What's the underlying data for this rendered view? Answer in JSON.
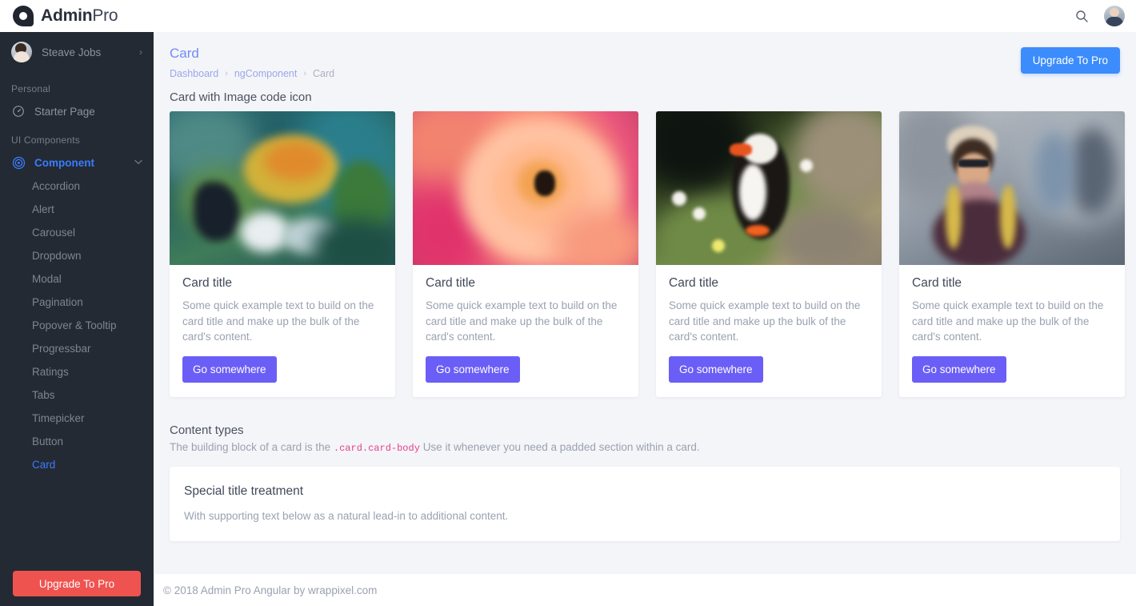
{
  "topbar": {
    "brand_bold": "Admin",
    "brand_light": "Pro",
    "search_icon": "search-icon",
    "avatar": "user-avatar"
  },
  "sidebar": {
    "profile": {
      "name": "Steave Jobs",
      "chevron": "›"
    },
    "sections": [
      {
        "label": "Personal"
      },
      {
        "label": "UI Components"
      }
    ],
    "starter_page": {
      "label": "Starter Page",
      "icon": "speedometer-icon"
    },
    "component": {
      "label": "Component",
      "icon": "target-icon",
      "chevron": "⌄"
    },
    "sub_items": [
      {
        "label": "Accordion",
        "active": false
      },
      {
        "label": "Alert",
        "active": false
      },
      {
        "label": "Carousel",
        "active": false
      },
      {
        "label": "Dropdown",
        "active": false
      },
      {
        "label": "Modal",
        "active": false
      },
      {
        "label": "Pagination",
        "active": false
      },
      {
        "label": "Popover & Tooltip",
        "active": false
      },
      {
        "label": "Progressbar",
        "active": false
      },
      {
        "label": "Ratings",
        "active": false
      },
      {
        "label": "Tabs",
        "active": false
      },
      {
        "label": "Timepicker",
        "active": false
      },
      {
        "label": "Button",
        "active": false
      },
      {
        "label": "Card",
        "active": true
      }
    ],
    "upgrade_label": "Upgrade To Pro"
  },
  "page": {
    "title": "Card",
    "breadcrumb": [
      {
        "label": "Dashboard",
        "current": false
      },
      {
        "label": "ngComponent",
        "current": false
      },
      {
        "label": "Card",
        "current": true
      }
    ],
    "breadcrumb_separator": "›",
    "upgrade_label": "Upgrade To Pro",
    "section_heading": "Card with Image code icon"
  },
  "cards": [
    {
      "image": "crab-photo",
      "title": "Card title",
      "text": "Some quick example text to build on the card title and make up the bulk of the card's content.",
      "button": "Go somewhere"
    },
    {
      "image": "rose-flower-photo",
      "title": "Card title",
      "text": "Some quick example text to build on the card title and make up the bulk of the card's content.",
      "button": "Go somewhere"
    },
    {
      "image": "puffin-bird-photo",
      "title": "Card title",
      "text": "Some quick example text to build on the card title and make up the bulk of the card's content.",
      "button": "Go somewhere"
    },
    {
      "image": "man-with-hat-photo",
      "title": "Card title",
      "text": "Some quick example text to build on the card title and make up the bulk of the card's content.",
      "button": "Go somewhere"
    }
  ],
  "content_types": {
    "heading": "Content types",
    "desc_before": "The building block of a card is the",
    "code": ".card.card-body",
    "desc_after": "Use it whenever you need a padded section within a card.",
    "panel_title": "Special title treatment",
    "panel_text": "With supporting text below as a natural lead-in to additional content."
  },
  "footer": {
    "text": "© 2018 Admin Pro Angular by wrappixel.com"
  },
  "colors": {
    "sidebar_bg": "#242a33",
    "page_bg": "#f4f5f9",
    "accent_blue": "#3a7bfd",
    "button_blue": "#3c8cfc",
    "button_purple": "#6b5ef6",
    "upgrade_red": "#ef5350",
    "code_pink": "#e83e8c"
  }
}
